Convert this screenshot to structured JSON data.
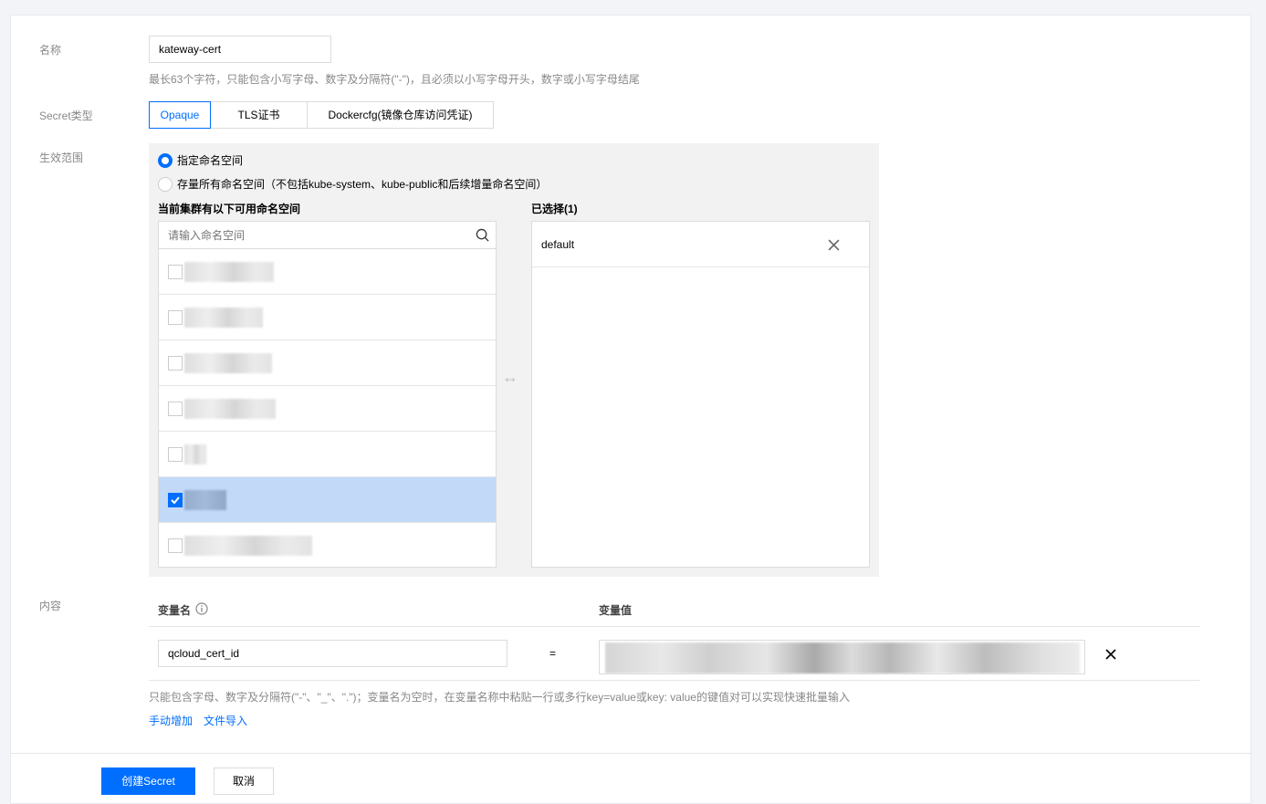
{
  "form": {
    "name_label": "名称",
    "name_value": "kateway-cert",
    "name_hint": "最长63个字符，只能包含小写字母、数字及分隔符(\"-\")，且必须以小写字母开头，数字或小写字母结尾",
    "type_label": "Secret类型",
    "type_options": [
      "Opaque",
      "TLS证书",
      "Dockercfg(镜像仓库访问凭证)"
    ],
    "type_selected": "Opaque",
    "scope_label": "生效范围",
    "scope_option_specified": "指定命名空间",
    "scope_option_all": "存量所有命名空间（不包括kube-system、kube-public和后续增量命名空间）",
    "available_title": "当前集群有以下可用命名空间",
    "search_placeholder": "请输入命名空间",
    "selected_title": "已选择(1)",
    "selected_items": [
      "default"
    ],
    "transfer_symbol": "↔",
    "content_label": "内容",
    "var_name_header": "变量名",
    "var_value_header": "变量值",
    "var_name_value": "qcloud_cert_id",
    "equals": "=",
    "content_hint": "只能包含字母、数字及分隔符(\"-\"、\"_\"、\".\")；变量名为空时，在变量名称中粘贴一行或多行key=value或key: value的键值对可以实现快速批量输入",
    "add_manual": "手动增加",
    "import_file": "文件导入"
  },
  "footer": {
    "create_button": "创建Secret",
    "cancel_button": "取消"
  },
  "colors": {
    "accent": "#006eff",
    "selected_row": "#c2d9f8"
  }
}
